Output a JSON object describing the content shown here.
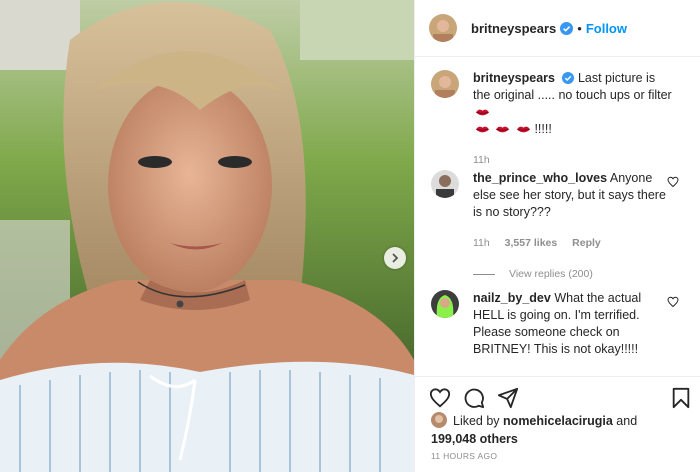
{
  "post": {
    "image_alt": "selfie photo",
    "next_icon": "chevron-right-icon"
  },
  "header": {
    "username": "britneyspears",
    "dot": "•",
    "follow_label": "Follow"
  },
  "caption": {
    "username": "britneyspears",
    "text": "Last picture is the original ..... no touch ups or filter",
    "suffix": "!!!!!",
    "emoji": "lips-icon",
    "time": "11h"
  },
  "comments": [
    {
      "username": "the_prince_who_loves",
      "text": "Anyone else see her story, but it says there is no story???",
      "time": "11h",
      "likes": "3,557 likes",
      "reply": "Reply",
      "view_replies": "View replies (200)"
    },
    {
      "username": "nailz_by_dev",
      "text": "What the actual HELL is going on. I'm terrified. Please someone check on BRITNEY! This is not okay!!!!!"
    }
  ],
  "likes": {
    "prefix": "Liked by",
    "user": "nomehicelacirugia",
    "and": "and",
    "others": "199,048 others"
  },
  "timestamp": "11 HOURS AGO",
  "colors": {
    "accent": "#0095f6",
    "text": "#262626",
    "muted": "#8e8e8e",
    "lips": "#c8102e"
  }
}
